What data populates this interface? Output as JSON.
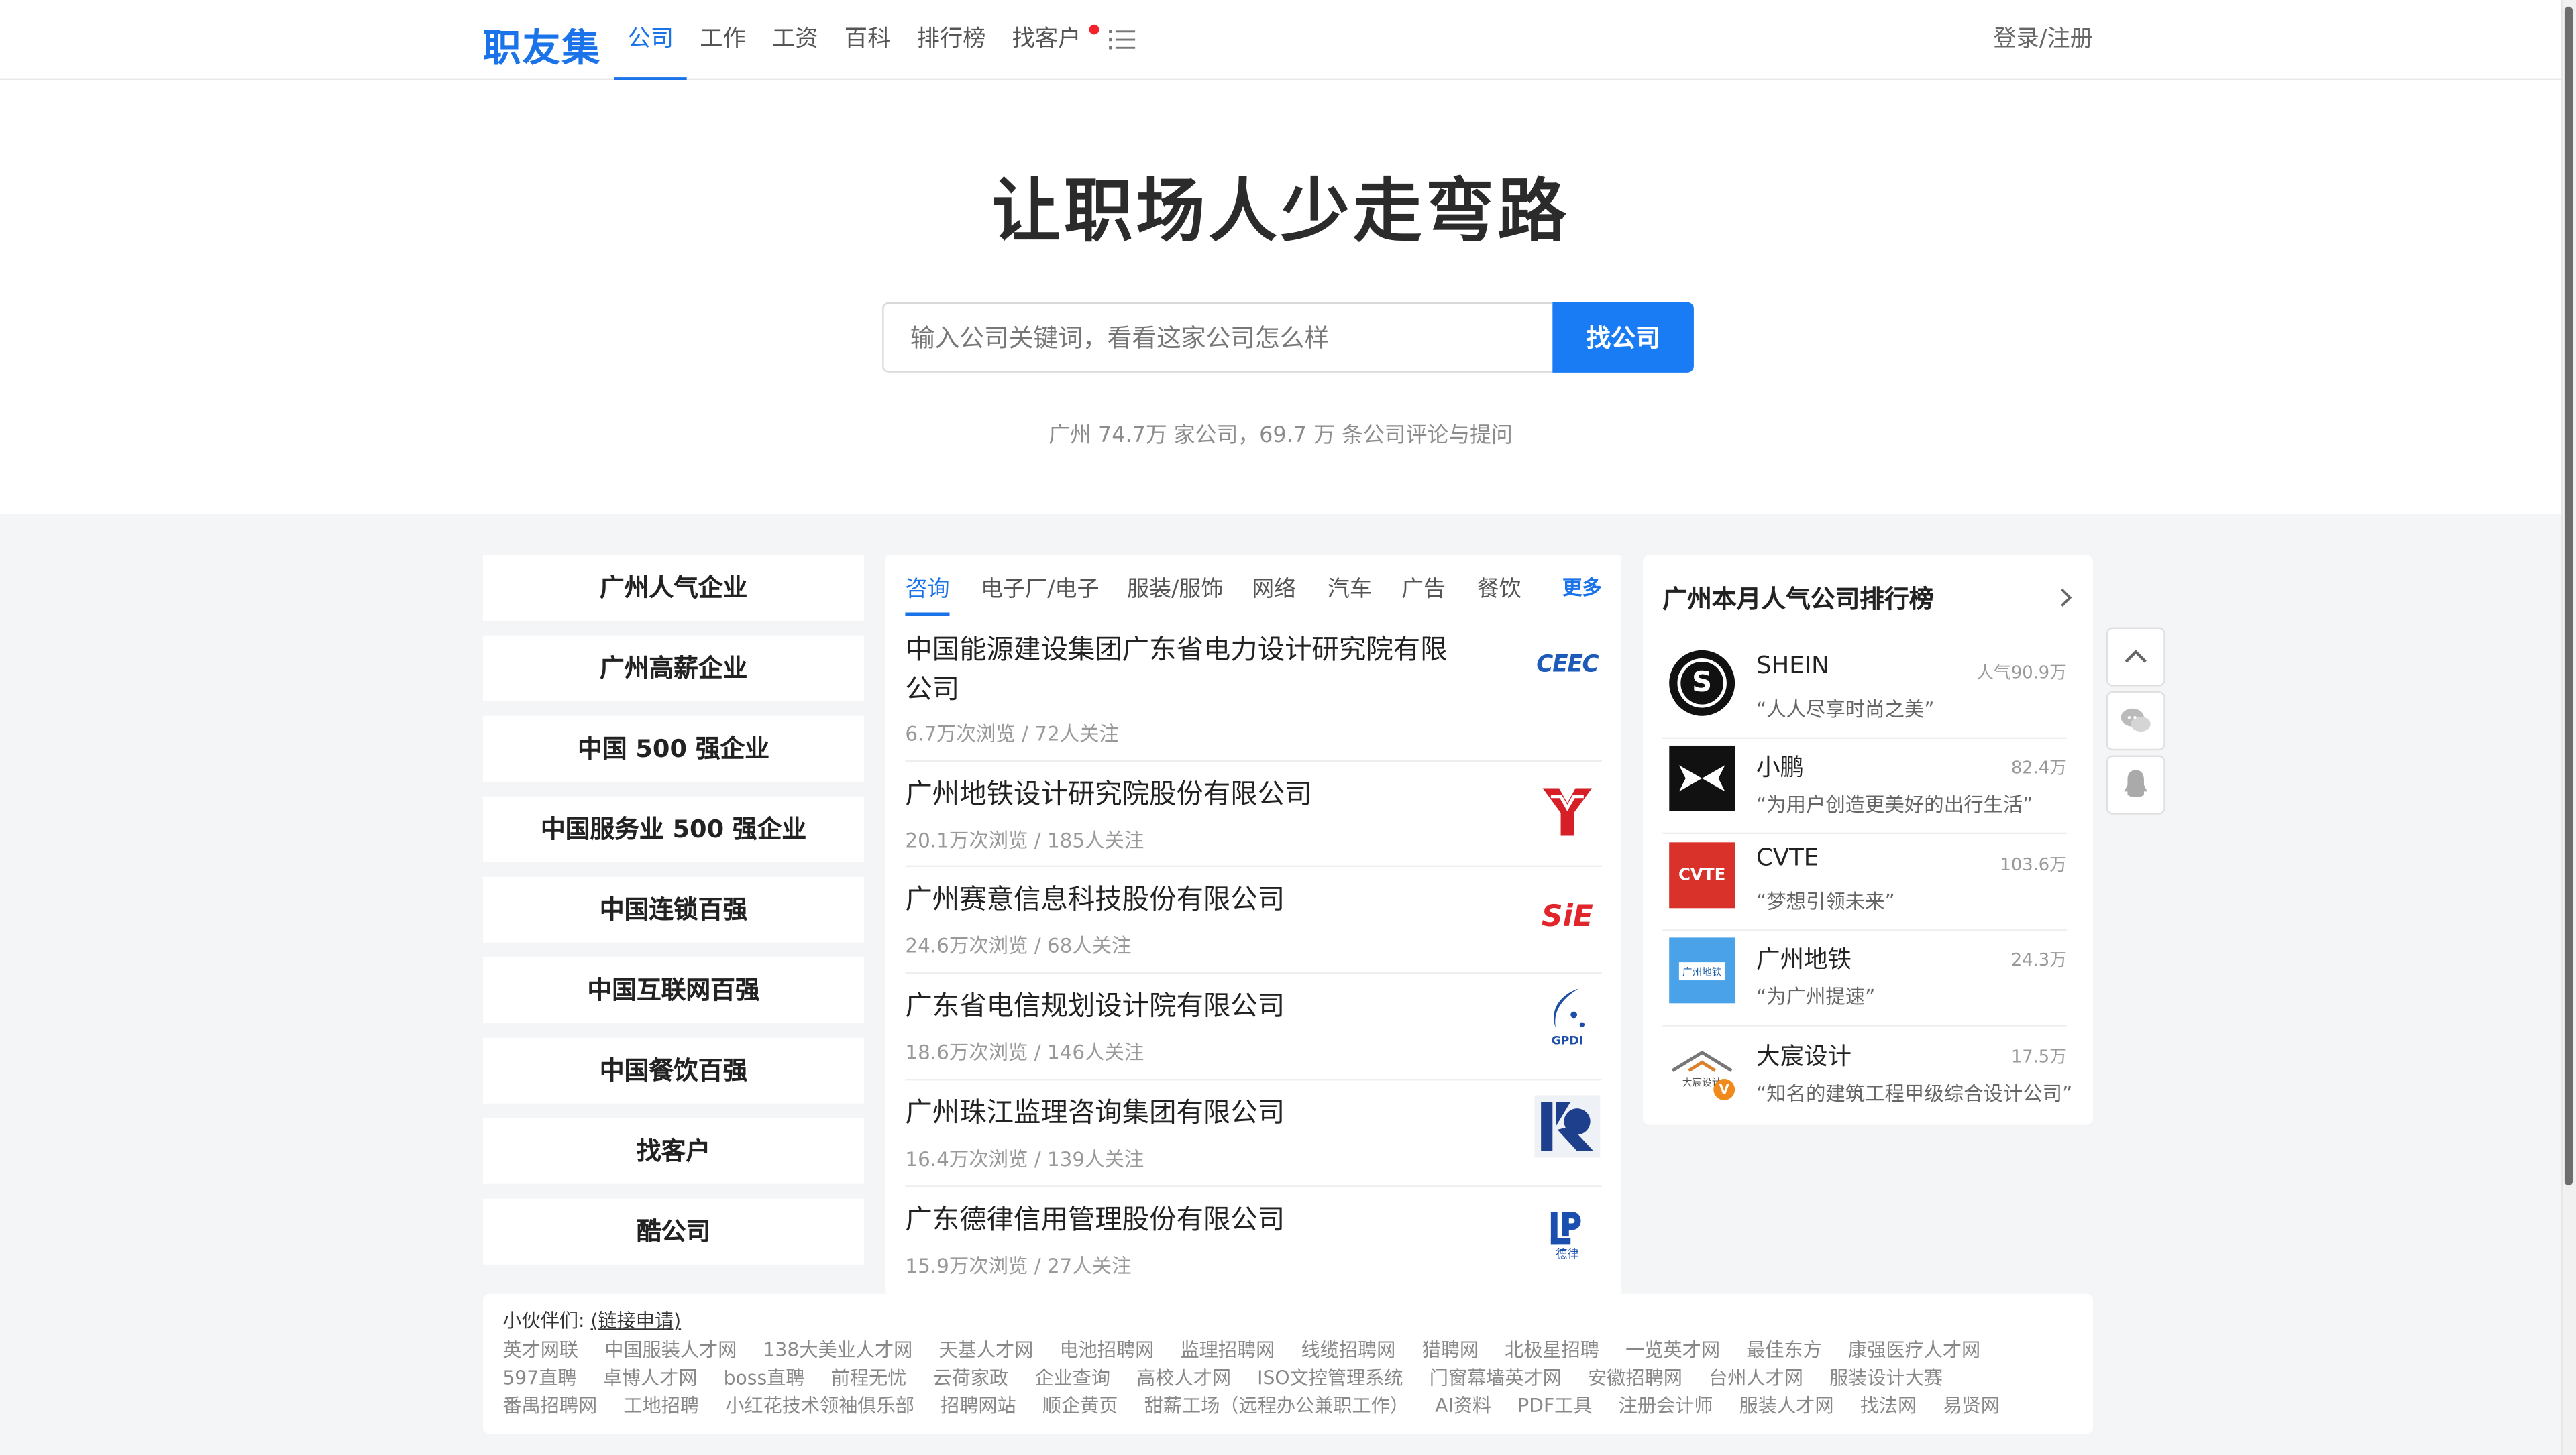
{
  "brand": "职友集",
  "nav": {
    "items": [
      "公司",
      "工作",
      "工资",
      "百科",
      "排行榜",
      "找客户"
    ],
    "login": "登录/注册"
  },
  "hero": {
    "title": "让职场人少走弯路",
    "search_placeholder": "输入公司关键词，看看这家公司怎么样",
    "search_button": "找公司",
    "stats": "广州 74.7万 家公司，69.7 万 条公司评论与提问"
  },
  "categories": [
    "广州人气企业",
    "广州高薪企业",
    "中国 500 强企业",
    "中国服务业 500 强企业",
    "中国连锁百强",
    "中国互联网百强",
    "中国餐饮百强",
    "找客户",
    "酷公司"
  ],
  "tabs": {
    "items": [
      "咨询",
      "电子厂/电子",
      "服装/服饰",
      "网络",
      "汽车",
      "广告",
      "餐饮"
    ],
    "more": "更多"
  },
  "companies": [
    {
      "name": "中国能源建设集团广东省电力设计研究院有限公司",
      "meta": "6.7万次浏览 / 72人关注",
      "logo_text": "CEEC",
      "logo_color": "#1e5bb8"
    },
    {
      "name": "广州地铁设计研究院股份有限公司",
      "meta": "20.1万次浏览 / 185人关注",
      "logo_text": "",
      "logo_color": "#d61f26"
    },
    {
      "name": "广州赛意信息科技股份有限公司",
      "meta": "24.6万次浏览 / 68人关注",
      "logo_text": "SiE",
      "logo_color": "#e0252b"
    },
    {
      "name": "广东省电信规划设计院有限公司",
      "meta": "18.6万次浏览 / 146人关注",
      "logo_text": "GPDI",
      "logo_color": "#1e4fa8"
    },
    {
      "name": "广州珠江监理咨询集团有限公司",
      "meta": "16.4万次浏览 / 139人关注",
      "logo_text": "",
      "logo_color": "#1e3f8c"
    },
    {
      "name": "广东德律信用管理股份有限公司",
      "meta": "15.9万次浏览 / 27人关注",
      "logo_text": "德律",
      "logo_color": "#1a4fb0"
    }
  ],
  "ranking": {
    "title": "广州本月人气公司排行榜",
    "items": [
      {
        "name": "SHEIN",
        "slogan": "“人人尽享时尚之美”",
        "popularity": "人气90.9万",
        "logo_text": "S"
      },
      {
        "name": "小鹏",
        "slogan": "“为用户创造更美好的出行生活”",
        "popularity": "82.4万",
        "logo_text": ""
      },
      {
        "name": "CVTE",
        "slogan": "“梦想引领未来”",
        "popularity": "103.6万",
        "logo_text": "CVTE"
      },
      {
        "name": "广州地铁",
        "slogan": "“为广州提速”",
        "popularity": "24.3万",
        "logo_text": "广州地铁"
      },
      {
        "name": "大宸设计",
        "slogan": "“知名的建筑工程甲级综合设计公司”",
        "popularity": "17.5万",
        "logo_text": "大宸设计"
      }
    ]
  },
  "partners": {
    "label": "小伙伴们:",
    "apply": "(链接申请)",
    "rows": [
      [
        "英才网联",
        "中国服装人才网",
        "138大美业人才网",
        "天基人才网",
        "电池招聘网",
        "监理招聘网",
        "线缆招聘网",
        "猎聘网",
        "北极星招聘",
        "一览英才网",
        "最佳东方",
        "康强医疗人才网"
      ],
      [
        "597直聘",
        "卓博人才网",
        "boss直聘",
        "前程无忧",
        "云荷家政",
        "企业查询",
        "高校人才网",
        "ISO文控管理系统",
        "门窗幕墙英才网",
        "安徽招聘网",
        "台州人才网",
        "服装设计大赛"
      ],
      [
        "番禺招聘网",
        "工地招聘",
        "小红花技术领袖俱乐部",
        "招聘网站",
        "顺企黄页",
        "甜薪工场（远程办公兼职工作）",
        "AI资料",
        "PDF工具",
        "注册会计师",
        "服装人才网",
        "找法网",
        "易贤网"
      ]
    ]
  },
  "colors": {
    "accent": "#1a73e8",
    "button": "#1a7cf5",
    "background": "#f4f5f7",
    "dot": "#f5222d"
  }
}
